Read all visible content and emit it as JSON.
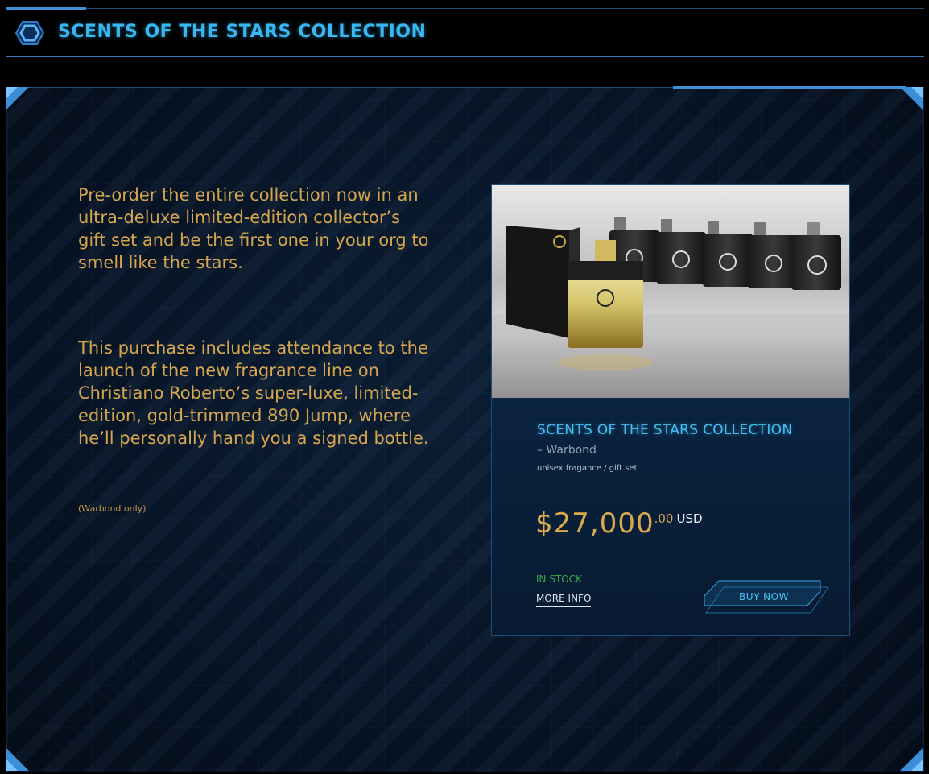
{
  "header": {
    "title": "SCENTS OF THE STARS COLLECTION",
    "icon": "hexagon-icon"
  },
  "description": {
    "paragraph1": "Pre-order the entire collection now in an ultra-deluxe limited-edition collector’s gift set and be the first one in your org to smell like the stars.",
    "paragraph2": "This purchase includes attendance to the launch of the new fragrance line on Christiano Roberto’s super-luxe, limited-edition, gold-trimmed 890 Jump, where he’ll personally hand you a signed bottle.",
    "note": "(Warbond only)"
  },
  "product": {
    "title": "SCENTS OF THE STARS COLLECTION",
    "subtitle": "– Warbond",
    "category": "unisex fragance / gift set",
    "price": {
      "amount": "$27,000",
      "cents": ".00",
      "currency": "USD"
    },
    "stock": "IN STOCK",
    "more_info": "MORE INFO",
    "buy_label": "BUY NOW"
  },
  "colors": {
    "accent_blue": "#37b8f2",
    "gold": "#d6a64f",
    "in_stock_green": "#3aaa44"
  }
}
